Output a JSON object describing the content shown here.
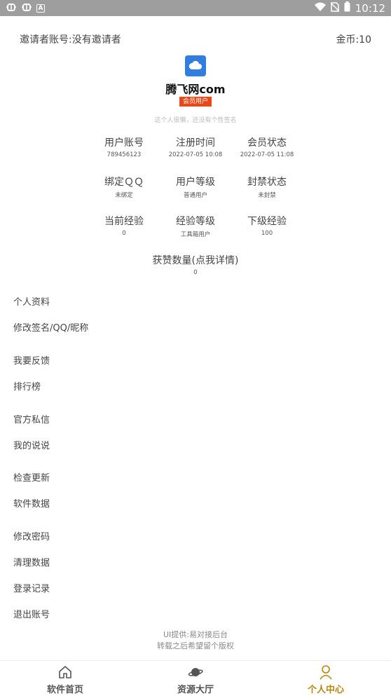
{
  "status_bar": {
    "left_icons": [
      "bug-icon",
      "bug-icon",
      "a-box-icon"
    ],
    "time": "10:12",
    "right_icons": [
      "wifi-icon",
      "sim-off-icon",
      "battery-icon"
    ]
  },
  "header": {
    "inviter": "邀请者账号:没有邀请者",
    "coins": "金币:10",
    "site_name": "腾飞网com",
    "badge": "会员用户",
    "signature": "这个人很懒，还没有个性签名"
  },
  "stats": [
    {
      "title": "用户账号",
      "value": "789456123"
    },
    {
      "title": "注册时间",
      "value": "2022-07-05 10:08"
    },
    {
      "title": "会员状态",
      "value": "2022-07-05 11:08"
    },
    {
      "title": "绑定ＱＱ",
      "value": "未绑定"
    },
    {
      "title": "用户等级",
      "value": "普通用户"
    },
    {
      "title": "封禁状态",
      "value": "未封禁"
    },
    {
      "title": "当前经验",
      "value": "0"
    },
    {
      "title": "经验等级",
      "value": "工具箱用户"
    },
    {
      "title": "下级经验",
      "value": "100"
    },
    {
      "title": "获赞数量(点我详情)",
      "value": "0"
    }
  ],
  "menu": [
    "个人资料",
    "修改签名/QQ/昵称",
    "我要反馈",
    "排行榜",
    "官方私信",
    "我的说说",
    "检查更新",
    "软件数据",
    "修改密码",
    "清理数据",
    "登录记录",
    "退出账号"
  ],
  "footer": {
    "line1": "UI提供:易对接后台",
    "line2": "转载之后希望留个版权"
  },
  "tabs": [
    {
      "label": "软件首页",
      "icon": "home-icon",
      "active": false
    },
    {
      "label": "资源大厅",
      "icon": "planet-icon",
      "active": false
    },
    {
      "label": "个人中心",
      "icon": "person-icon",
      "active": true
    }
  ],
  "colors": {
    "status_bar": "#9e9e9e",
    "avatar": "#2f7ee0",
    "badge": "#e84a17",
    "active_tab": "#b8860b"
  }
}
